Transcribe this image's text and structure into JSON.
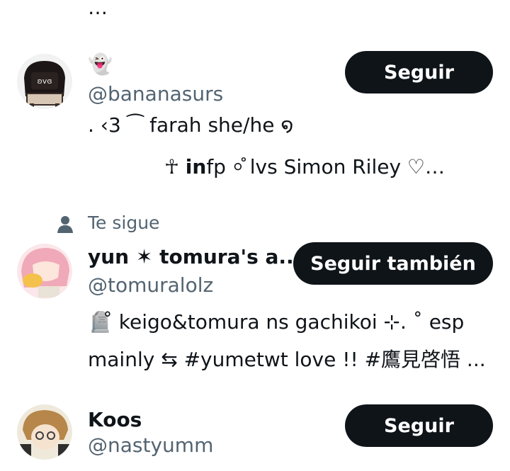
{
  "top_ellipsis": "…",
  "users": [
    {
      "name": "👻",
      "handle": "@bananasurs",
      "follow_label": "Seguir",
      "bio_line1": ".    ‹3     ⁀     farah     she/he     ໑",
      "bio_line2_pre": "☥  ",
      "bio_line2_bold": "in",
      "bio_line2_mid": "fp  ⸰̊     lvs Simon Riley  ♡…"
    },
    {
      "context": "Te sigue",
      "name": "yun ✶ tomura's a...",
      "handle": "@tomuralolz",
      "follow_label": "Seguir también",
      "bio_line1": "🪦̊ keigo&tomura ns gachikoi ⊹. ˚ esp",
      "bio_line2": "mainly  ⇆  #yumetwt love !! #鷹見啓悟 ..."
    },
    {
      "name": "Koos",
      "handle": "@nastyumm",
      "follow_label": "Seguir"
    }
  ],
  "colors": {
    "button_bg": "#0f1419",
    "secondary_text": "#536471"
  }
}
